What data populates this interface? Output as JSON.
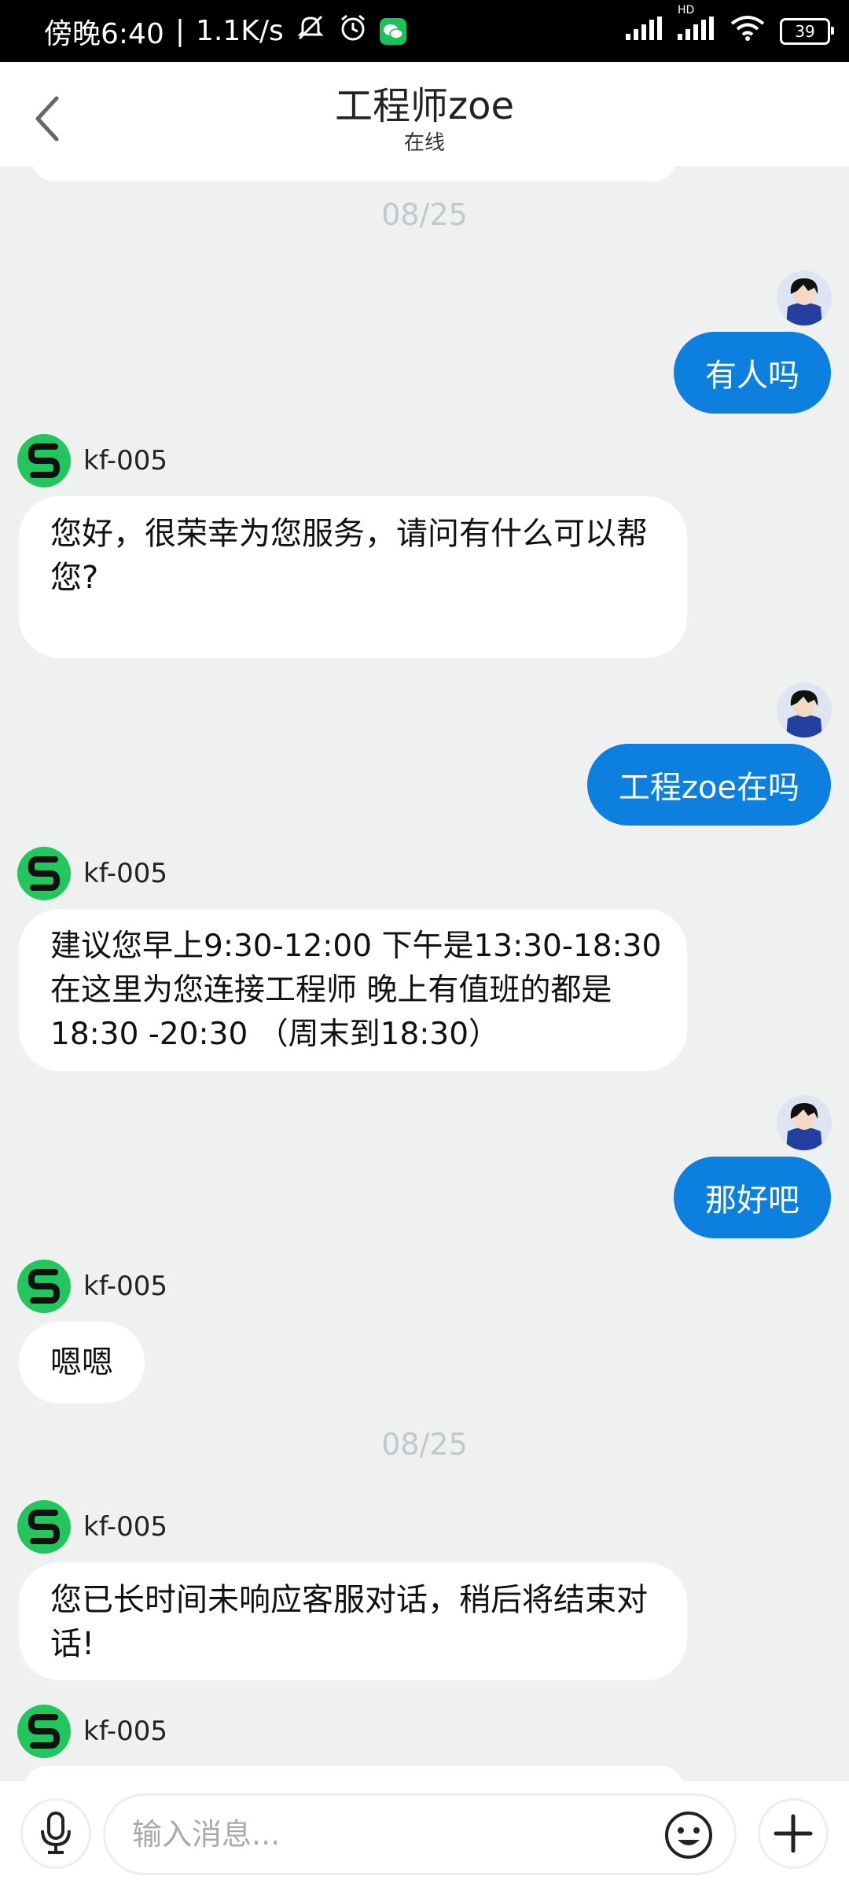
{
  "status_bar": {
    "time": "傍晚6:40",
    "speed": "1.1K/s",
    "battery": "39",
    "network_label": "HD"
  },
  "header": {
    "title": "工程师zoe",
    "subtitle": "在线"
  },
  "messages": {
    "date_1": "08/25",
    "m1_text": "有人吗",
    "agent_name": "kf-005",
    "m2_text": "您好，很荣幸为您服务，请问有什么可以帮您?",
    "m3_text": "工程zoe在吗",
    "m4_line1": "建议您早上9:30-12:00  下午是13:30-18:30",
    "m4_line2": "在这里为您连接工程师  晚上有值班的都是",
    "m4_line3": "18:30  -20:30  （周末到18:30）",
    "m5_text": "那好吧",
    "m6_text": "嗯嗯",
    "date_2": "08/25",
    "m7_text": "您已长时间未响应客服对话，稍后将结束对话!"
  },
  "input": {
    "placeholder": "输入消息..."
  },
  "colors": {
    "accent": "#0c7fdf",
    "agent_avatar": "#22c55e",
    "background": "#eff0f0"
  },
  "icons": {
    "back": "chevron-left-icon",
    "mic": "microphone-icon",
    "emoji": "emoji-icon",
    "plus": "plus-icon"
  }
}
